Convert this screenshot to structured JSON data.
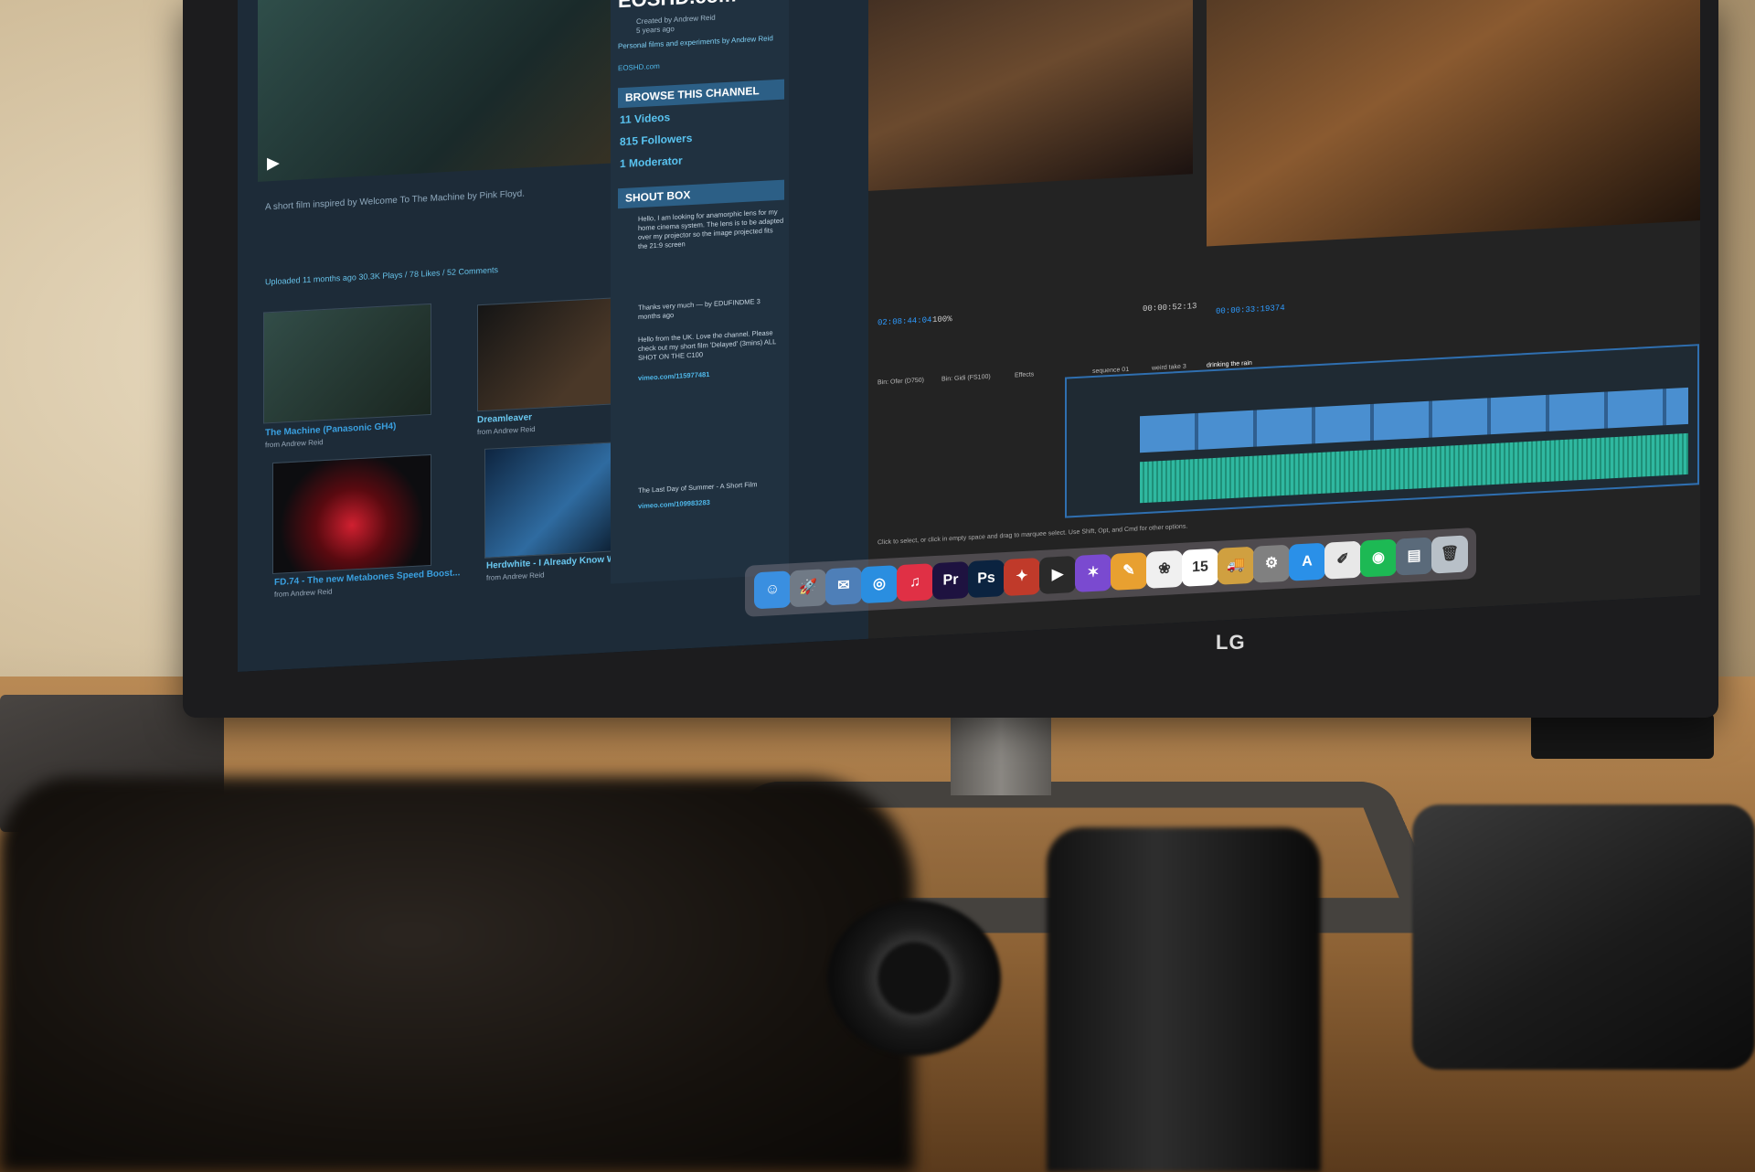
{
  "browser": {
    "site_title": "EOSHD.com",
    "created_by": "Created by Andrew Reid",
    "age": "5 years ago",
    "tagline": "Personal films and experiments by Andrew Reid",
    "site_link": "EOSHD.com",
    "browse_heading": "BROWSE THIS CHANNEL",
    "stats": [
      "11 Videos",
      "815 Followers",
      "1 Moderator"
    ],
    "shout_heading": "SHOUT BOX",
    "shout_messages": [
      "Hello, I am looking for anamorphic lens for my home cinema system. The lens is to be adapted over my projector so the image projected fits the 21:9 screen",
      "Thanks very much — by EDUFINDME 3 months ago",
      "Hello from the UK. Love the channel. Please check out my short film 'Delayed' (3mins) ALL SHOT ON THE C100",
      "vimeo.com/115977481",
      "The Last Day of Summer - A Short Film",
      "vimeo.com/109983283"
    ],
    "video_caption": "A short film inspired by Welcome To The Machine by Pink Floyd.",
    "video_meta": "Uploaded 11 months ago   30.3K Plays / 78 Likes / 52 Comments",
    "thumbs": [
      {
        "title": "The Machine (Panasonic GH4)",
        "author": "from Andrew Reid"
      },
      {
        "title": "Dreamleaver",
        "author": "from Andrew Reid"
      },
      {
        "title": "FD.74 - The new Metabones Speed Boost...",
        "author": "from Andrew Reid"
      },
      {
        "title": "Herdwhite - I Already Know What For",
        "author": "from Andrew Reid"
      }
    ]
  },
  "premiere": {
    "tc_left": "02:08:44:04",
    "zoom": "100%",
    "tc_mid": "00:00:52:13",
    "tc_right": "00:00:33:19374",
    "tabs": [
      "Bin: Ofer (D750)",
      "Bin: Gidi (FS100)",
      "Effects",
      "sequence 01",
      "weird take 3",
      "drinking the rain"
    ],
    "status": "Click to select, or click in empty space and drag to marquee select. Use Shift, Opt, and Cmd for other options."
  },
  "dock": {
    "icons": [
      {
        "name": "finder-icon",
        "glyph": "☺",
        "color": "#3a8fe0"
      },
      {
        "name": "launchpad-icon",
        "glyph": "🚀",
        "color": "#707a86"
      },
      {
        "name": "preview-icon",
        "glyph": "✉",
        "color": "#4e7fb8"
      },
      {
        "name": "safari-icon",
        "glyph": "◎",
        "color": "#2a8ee0"
      },
      {
        "name": "music-icon",
        "glyph": "♫",
        "color": "#e03045"
      },
      {
        "name": "premiere-icon",
        "glyph": "Pr",
        "color": "#1e1240"
      },
      {
        "name": "photoshop-icon",
        "glyph": "Ps",
        "color": "#0b2340"
      },
      {
        "name": "resolve-icon",
        "glyph": "✦",
        "color": "#c03a2a"
      },
      {
        "name": "motion-icon",
        "glyph": "▶",
        "color": "#2a2a2a"
      },
      {
        "name": "fcpx-icon",
        "glyph": "✶",
        "color": "#7a4ad0"
      },
      {
        "name": "pages-icon",
        "glyph": "✎",
        "color": "#e8a030"
      },
      {
        "name": "photos-icon",
        "glyph": "❀",
        "color": "#f0f0f0"
      },
      {
        "name": "calendar-icon",
        "glyph": "15",
        "color": "#ffffff"
      },
      {
        "name": "transmit-icon",
        "glyph": "🚚",
        "color": "#d0a040"
      },
      {
        "name": "system-prefs-icon",
        "glyph": "⚙",
        "color": "#808080"
      },
      {
        "name": "appstore-icon",
        "glyph": "A",
        "color": "#2a90e8"
      },
      {
        "name": "textedit-icon",
        "glyph": "✐",
        "color": "#e8e8e8"
      },
      {
        "name": "spotify-icon",
        "glyph": "◉",
        "color": "#1db954"
      },
      {
        "name": "downloads-icon",
        "glyph": "▤",
        "color": "#5a6a7a"
      },
      {
        "name": "trash-icon",
        "glyph": "🗑",
        "color": "#b8c0c8"
      }
    ]
  },
  "brand": "LG"
}
